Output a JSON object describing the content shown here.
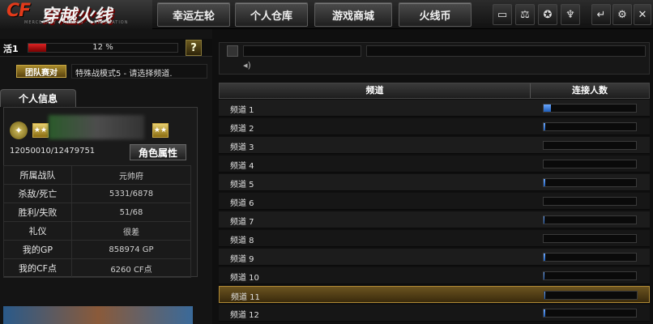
{
  "logo": {
    "brand": "CF",
    "title": "穿越火线",
    "subtitle": "MERCENARY · FORCES · CORPORATION"
  },
  "nav": {
    "lucky_wheel": "幸运左轮",
    "warehouse": "个人仓库",
    "shop": "游戏商城",
    "coins": "火线币"
  },
  "top_icons": [
    "tv-icon",
    "scales-icon",
    "shield-star-icon",
    "trophy-icon",
    "back-arrow-icon",
    "settings-icon",
    "close-icon"
  ],
  "player": {
    "level_label": "活1",
    "xp_percent_text": "12 %",
    "xp_percent": 12,
    "help": "?",
    "room_badge": "团队赛对",
    "mode_text": "特殊战模式5 - 请选择频道.",
    "info_tab": "个人信息",
    "xp_total": "12050010/12479751",
    "role_button": "角色属性",
    "stats": [
      {
        "key": "所属战队",
        "value": "元帅府"
      },
      {
        "key": "杀敌/死亡",
        "value": "5331/6878"
      },
      {
        "key": "胜利/失败",
        "value": "51/68"
      },
      {
        "key": "礼仪",
        "value": "很差"
      },
      {
        "key": "我的GP",
        "value": "858974 GP"
      },
      {
        "key": "我的CF点",
        "value": "6260 CF点"
      }
    ]
  },
  "channels": {
    "header_channel": "频道",
    "header_count": "连接人数",
    "rows": [
      {
        "name": "频道 1",
        "load": 0.08
      },
      {
        "name": "频道 2",
        "load": 0.02
      },
      {
        "name": "频道 3",
        "load": 0.0
      },
      {
        "name": "频道 4",
        "load": 0.0
      },
      {
        "name": "频道 5",
        "load": 0.02
      },
      {
        "name": "频道 6",
        "load": 0.0
      },
      {
        "name": "频道 7",
        "load": 0.01
      },
      {
        "name": "频道 8",
        "load": 0.0
      },
      {
        "name": "频道 9",
        "load": 0.02
      },
      {
        "name": "频道 10",
        "load": 0.01
      },
      {
        "name": "频道 11",
        "load": 0.01,
        "selected": true
      },
      {
        "name": "频道 12",
        "load": 0.02
      }
    ]
  }
}
